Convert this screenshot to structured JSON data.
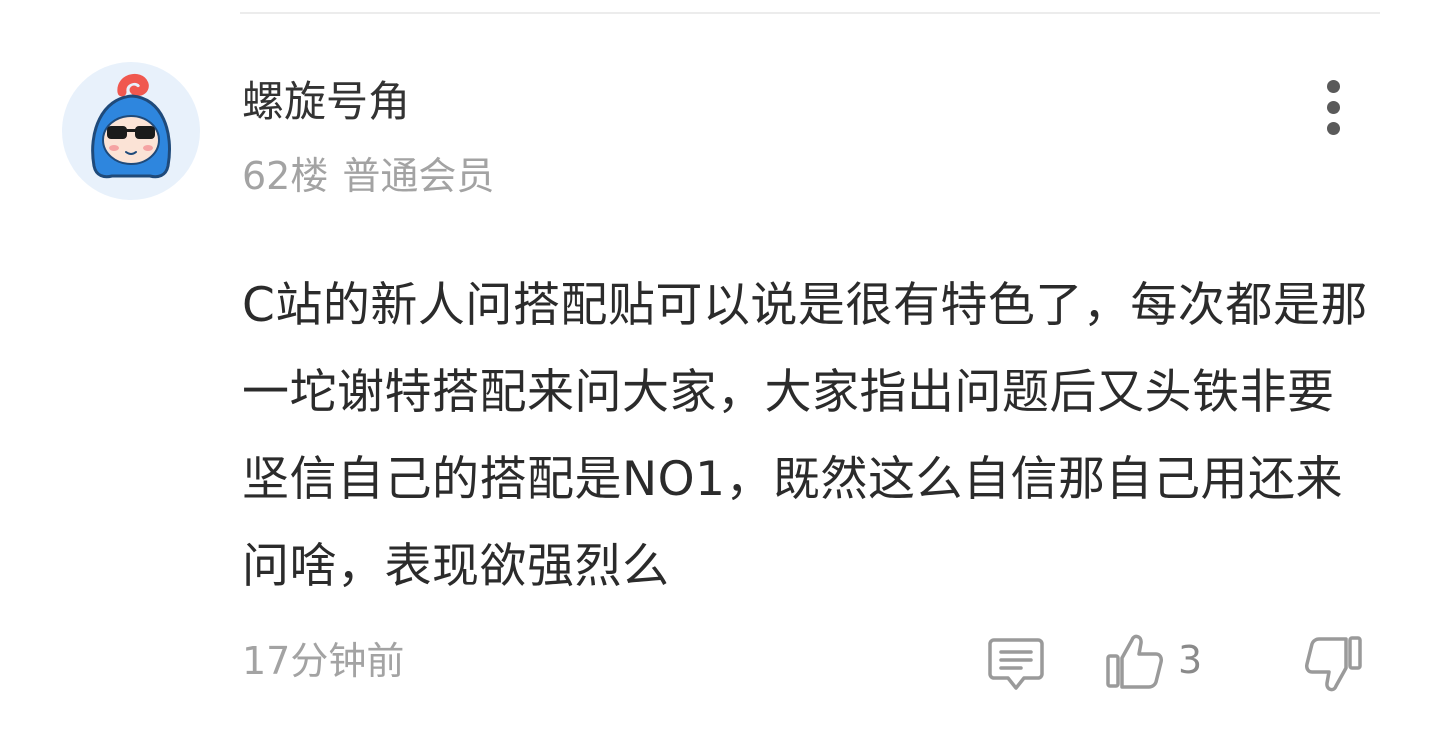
{
  "comment": {
    "username": "螺旋号角",
    "floor": "62楼",
    "member_level": "普通会员",
    "body": "C站的新人问搭配贴可以说是很有特色了，每次都是那一坨谢特搭配来问大家，大家指出问题后又头铁非要坚信自己的搭配是NO1，既然这么自信那自己用还来问啥，表现欲强烈么",
    "timestamp": "17分钟前",
    "like_count": "3"
  },
  "icons": {
    "more": "more-vertical-icon",
    "reply": "comment-icon",
    "like": "thumbs-up-icon",
    "dislike": "thumbs-down-icon"
  },
  "colors": {
    "username": "#333333",
    "meta": "#a3a3a3",
    "body": "#2b2b2b",
    "icon": "#9a9a9a",
    "avatar_bg": "#e8f1fb",
    "avatar_blue": "#2e86de",
    "avatar_red": "#f0584f"
  }
}
